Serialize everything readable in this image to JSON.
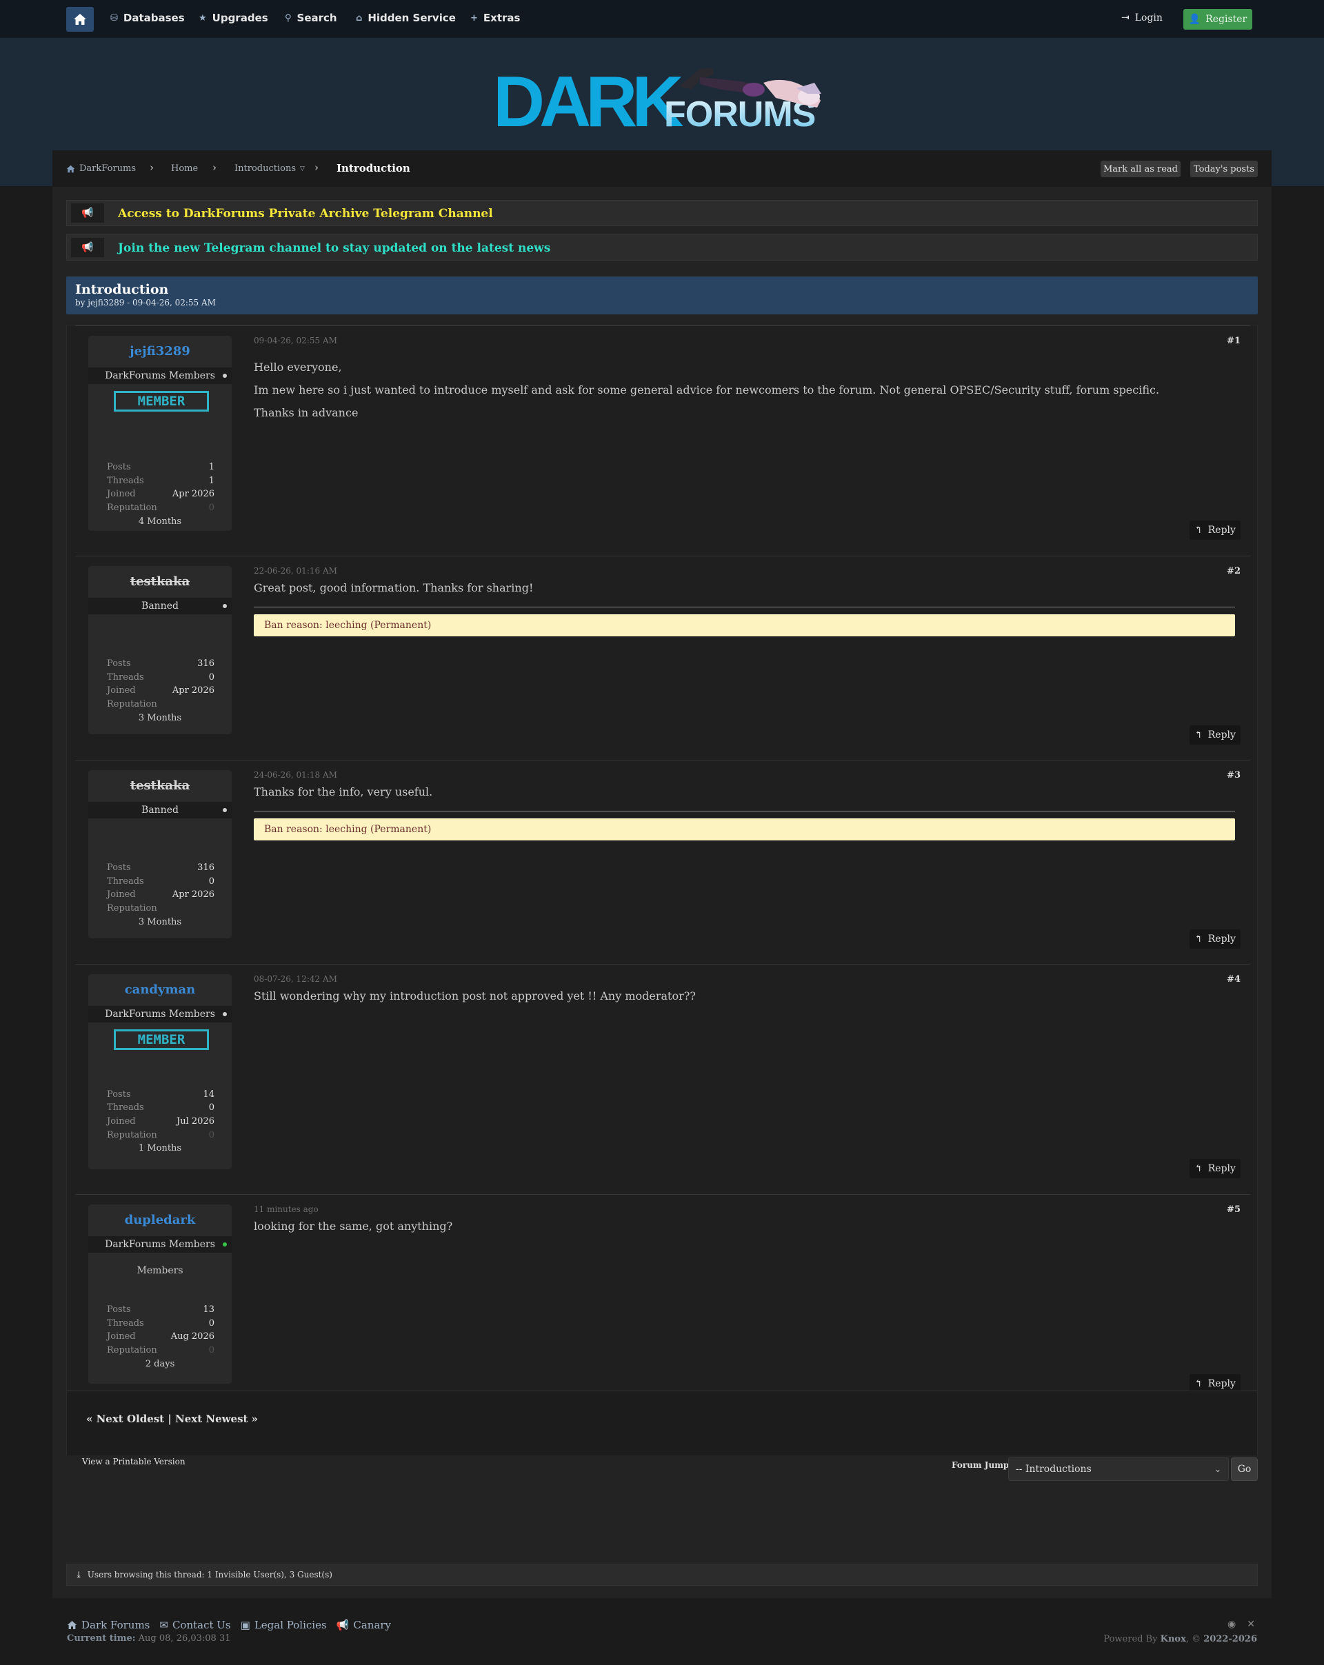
{
  "nav": {
    "items": [
      {
        "label": "Databases",
        "icon": "database-icon"
      },
      {
        "label": "Upgrades",
        "icon": "star-icon"
      },
      {
        "label": "Search",
        "icon": "search-icon"
      },
      {
        "label": "Hidden Service",
        "icon": "building-icon"
      },
      {
        "label": "Extras",
        "icon": "plus-icon"
      }
    ],
    "login": "Login",
    "register": "Register"
  },
  "logo": {
    "dark": "DARK",
    "forums": "FORUMS"
  },
  "breadcrumb": {
    "items": [
      "DarkForums",
      "Home",
      "Introductions"
    ],
    "current": "Introduction",
    "mark_read": "Mark all as read",
    "todays_posts": "Today's posts"
  },
  "announcements": [
    {
      "text": "Access to DarkForums Private Archive Telegram Channel",
      "color": "#f5e63a"
    },
    {
      "text": "Join the new Telegram channel to stay updated on the latest news",
      "color": "#2ee0c8"
    }
  ],
  "thread": {
    "title": "Introduction",
    "subtitle": "by jejfi3289 - 09-04-26, 02:55 AM"
  },
  "posts": [
    {
      "user": "jejfi3289",
      "banned": false,
      "role": "DarkForums Members",
      "online": false,
      "badge": "MEMBER",
      "member_text": "",
      "stats": {
        "posts": "1",
        "threads": "1",
        "joined": "Apr 2026",
        "reputation": "0"
      },
      "tenure": "4 Months",
      "date": "09-04-26, 02:55 AM",
      "number": "#1",
      "body": [
        "Hello everyone,",
        "Im new here so i just wanted to introduce myself and ask for some general advice for newcomers to the forum. Not general OPSEC/Security stuff, forum specific.",
        "Thanks in advance"
      ],
      "ban_reason": ""
    },
    {
      "user": "testkaka",
      "banned": true,
      "role": "Banned",
      "online": false,
      "badge": "",
      "member_text": "",
      "stats": {
        "posts": "316",
        "threads": "0",
        "joined": "Apr 2026",
        "reputation": ""
      },
      "tenure": "3 Months",
      "date": "22-06-26, 01:16 AM",
      "number": "#2",
      "body": [
        "Great post, good information. Thanks for sharing!"
      ],
      "ban_reason": "Ban reason: leeching (Permanent)"
    },
    {
      "user": "testkaka",
      "banned": true,
      "role": "Banned",
      "online": false,
      "badge": "",
      "member_text": "",
      "stats": {
        "posts": "316",
        "threads": "0",
        "joined": "Apr 2026",
        "reputation": ""
      },
      "tenure": "3 Months",
      "date": "24-06-26, 01:18 AM",
      "number": "#3",
      "body": [
        "Thanks for the info, very useful."
      ],
      "ban_reason": "Ban reason: leeching (Permanent)"
    },
    {
      "user": "candyman",
      "banned": false,
      "role": "DarkForums Members",
      "online": false,
      "badge": "MEMBER",
      "member_text": "",
      "stats": {
        "posts": "14",
        "threads": "0",
        "joined": "Jul 2026",
        "reputation": "0"
      },
      "tenure": "1 Months",
      "date": "08-07-26, 12:42 AM",
      "number": "#4",
      "body": [
        "Still wondering why my introduction post not approved yet !! Any moderator??"
      ],
      "ban_reason": ""
    },
    {
      "user": "dupledark",
      "banned": false,
      "role": "DarkForums Members",
      "online": true,
      "badge": "",
      "member_text": "Members",
      "stats": {
        "posts": "13",
        "threads": "0",
        "joined": "Aug 2026",
        "reputation": "0"
      },
      "tenure": "2 days",
      "date": "11 minutes ago",
      "number": "#5",
      "body": [
        "looking for the same, got anything?"
      ],
      "ban_reason": ""
    }
  ],
  "labels": {
    "posts": "Posts",
    "threads": "Threads",
    "joined": "Joined",
    "reputation": "Reputation",
    "reply": "Reply"
  },
  "pager": "« Next Oldest | Next Newest »",
  "printable": "View a Printable Version",
  "forum_jump": {
    "label": "Forum Jump:",
    "selected": "-- Introductions",
    "go": "Go"
  },
  "browsing": "Users browsing this thread: 1 Invisible User(s), 3 Guest(s)",
  "footer": {
    "links": [
      {
        "label": "Dark Forums",
        "icon": "home-icon"
      },
      {
        "label": "Contact Us",
        "icon": "envelope-icon"
      },
      {
        "label": "Legal Policies",
        "icon": "briefcase-icon"
      },
      {
        "label": "Canary",
        "icon": "megaphone-icon"
      }
    ],
    "time_label": "Current time:",
    "time_value": "Aug 08, 26,03:08 31",
    "powered_prefix": "Powered By",
    "powered_by": "Knox",
    "copyright_prefix": ", ©",
    "copyright": "2022-2026"
  }
}
